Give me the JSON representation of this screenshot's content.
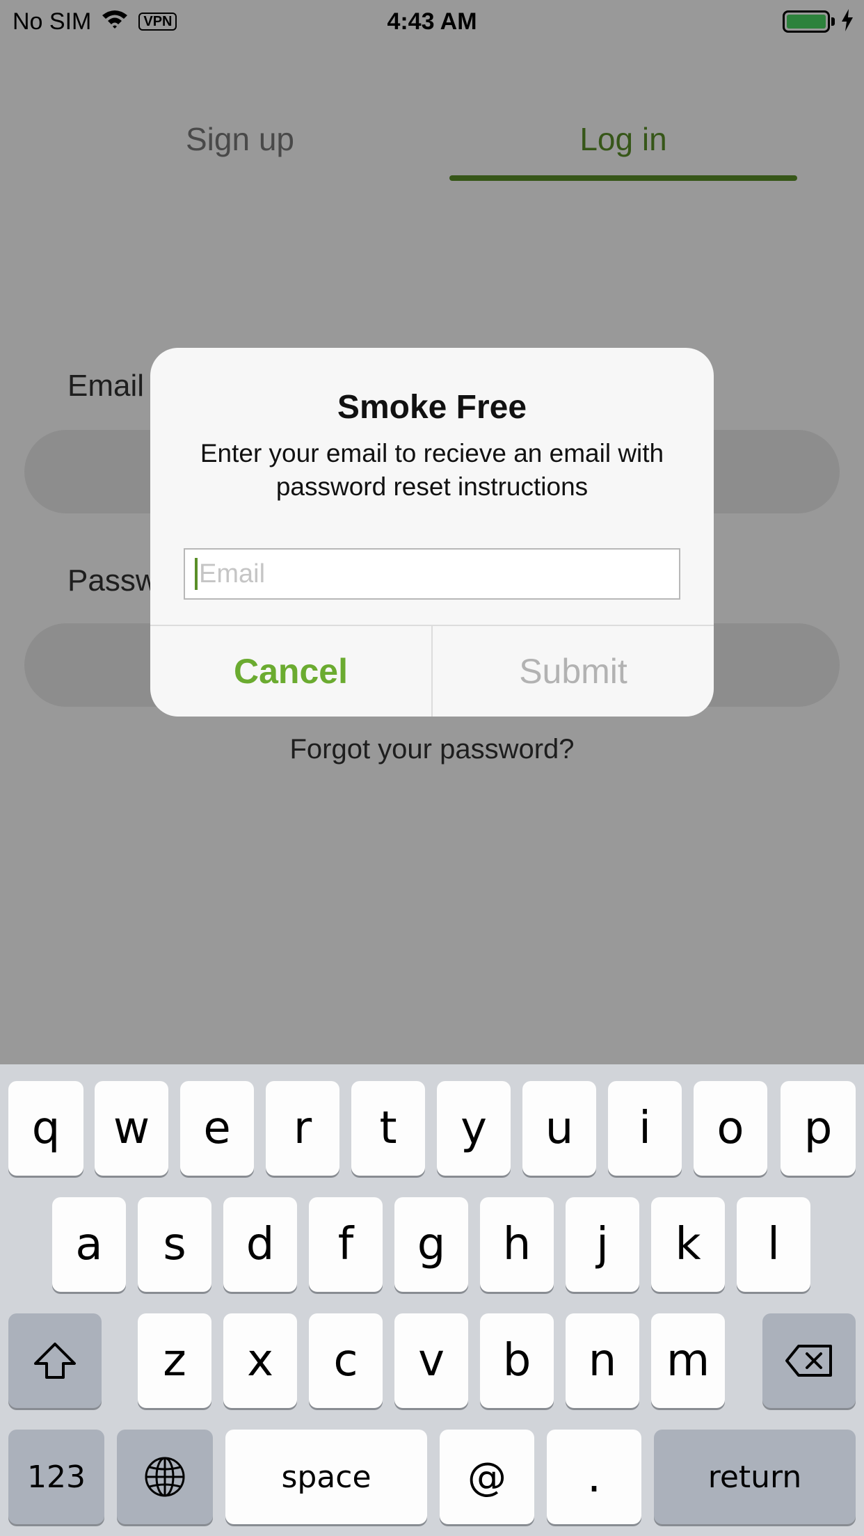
{
  "status_bar": {
    "carrier": "No SIM",
    "vpn": "VPN",
    "time": "4:43 AM",
    "battery_color": "#4cd964"
  },
  "tabs": [
    {
      "label": "Sign up",
      "active": false
    },
    {
      "label": "Log in",
      "active": true
    }
  ],
  "form": {
    "email_label": "Email",
    "password_label": "Password",
    "forgot_link": "Forgot your password?"
  },
  "alert": {
    "title": "Smoke Free",
    "message": "Enter your email to recieve an email with password reset instructions",
    "input_placeholder": "Email",
    "cancel_label": "Cancel",
    "submit_label": "Submit"
  },
  "keyboard": {
    "row1": [
      "q",
      "w",
      "e",
      "r",
      "t",
      "y",
      "u",
      "i",
      "o",
      "p"
    ],
    "row2": [
      "a",
      "s",
      "d",
      "f",
      "g",
      "h",
      "j",
      "k",
      "l"
    ],
    "row3": [
      "z",
      "x",
      "c",
      "v",
      "b",
      "n",
      "m"
    ],
    "numbers_key": "123",
    "space_key": "space",
    "at_key": "@",
    "dot_key": ".",
    "return_key": "return"
  },
  "colors": {
    "accent_green": "#5a8f29",
    "cancel_green": "#6bab30"
  }
}
